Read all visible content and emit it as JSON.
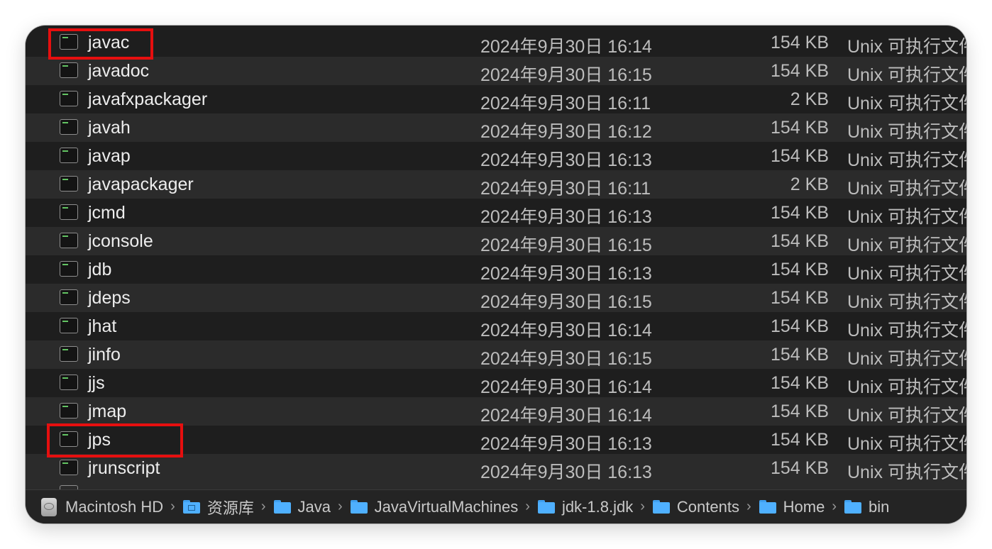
{
  "files": [
    {
      "name": "javac",
      "date": "2024年9月30日 16:14",
      "size": "154 KB",
      "kind": "Unix 可执行文件"
    },
    {
      "name": "javadoc",
      "date": "2024年9月30日 16:15",
      "size": "154 KB",
      "kind": "Unix 可执行文件"
    },
    {
      "name": "javafxpackager",
      "date": "2024年9月30日 16:11",
      "size": "2 KB",
      "kind": "Unix 可执行文件"
    },
    {
      "name": "javah",
      "date": "2024年9月30日 16:12",
      "size": "154 KB",
      "kind": "Unix 可执行文件"
    },
    {
      "name": "javap",
      "date": "2024年9月30日 16:13",
      "size": "154 KB",
      "kind": "Unix 可执行文件"
    },
    {
      "name": "javapackager",
      "date": "2024年9月30日 16:11",
      "size": "2 KB",
      "kind": "Unix 可执行文件"
    },
    {
      "name": "jcmd",
      "date": "2024年9月30日 16:13",
      "size": "154 KB",
      "kind": "Unix 可执行文件"
    },
    {
      "name": "jconsole",
      "date": "2024年9月30日 16:15",
      "size": "154 KB",
      "kind": "Unix 可执行文件"
    },
    {
      "name": "jdb",
      "date": "2024年9月30日 16:13",
      "size": "154 KB",
      "kind": "Unix 可执行文件"
    },
    {
      "name": "jdeps",
      "date": "2024年9月30日 16:15",
      "size": "154 KB",
      "kind": "Unix 可执行文件"
    },
    {
      "name": "jhat",
      "date": "2024年9月30日 16:14",
      "size": "154 KB",
      "kind": "Unix 可执行文件"
    },
    {
      "name": "jinfo",
      "date": "2024年9月30日 16:15",
      "size": "154 KB",
      "kind": "Unix 可执行文件"
    },
    {
      "name": "jjs",
      "date": "2024年9月30日 16:14",
      "size": "154 KB",
      "kind": "Unix 可执行文件"
    },
    {
      "name": "jmap",
      "date": "2024年9月30日 16:14",
      "size": "154 KB",
      "kind": "Unix 可执行文件"
    },
    {
      "name": "jps",
      "date": "2024年9月30日 16:13",
      "size": "154 KB",
      "kind": "Unix 可执行文件"
    },
    {
      "name": "jrunscript",
      "date": "2024年9月30日 16:13",
      "size": "154 KB",
      "kind": "Unix 可执行文件"
    }
  ],
  "path_bar": [
    {
      "label": "Macintosh HD",
      "icon": "hard-drive-icon"
    },
    {
      "label": "资源库",
      "icon": "library-folder-icon"
    },
    {
      "label": "Java",
      "icon": "folder-icon"
    },
    {
      "label": "JavaVirtualMachines",
      "icon": "folder-icon"
    },
    {
      "label": "jdk-1.8.jdk",
      "icon": "folder-icon"
    },
    {
      "label": "Contents",
      "icon": "folder-icon"
    },
    {
      "label": "Home",
      "icon": "folder-icon"
    },
    {
      "label": "bin",
      "icon": "folder-icon"
    }
  ],
  "path_separator": "›",
  "colors": {
    "window_bg": "#1e1e1e",
    "row_alt_bg": "#2b2b2b",
    "highlight_border": "#e60f0f",
    "folder_blue": "#4fb0ff"
  }
}
